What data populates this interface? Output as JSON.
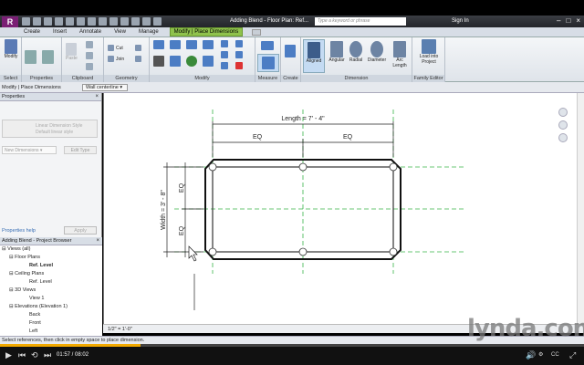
{
  "titlebar": {
    "app_logo": "R",
    "title": "Adding Blend - Floor Plan: Ref...",
    "search_placeholder": "Type a keyword or phrase",
    "sign_in": "Sign In"
  },
  "tabs": [
    "Create",
    "Insert",
    "Annotate",
    "View",
    "Manage",
    "Modify | Place Dimensions"
  ],
  "active_tab": "Modify | Place Dimensions",
  "ribbon": {
    "select": {
      "modify": "Modify",
      "label": "Select"
    },
    "properties": {
      "label": "Properties"
    },
    "clipboard": {
      "paste": "Paste",
      "label": "Clipboard"
    },
    "geometry": {
      "cut": "Cut",
      "join": "Join",
      "label": "Geometry"
    },
    "modify": {
      "label": "Modify"
    },
    "measure": {
      "label": "Measure"
    },
    "create": {
      "label": "Create"
    },
    "dimension": {
      "label": "Dimension",
      "tools": [
        "Aligned",
        "Angular",
        "Radial",
        "Diameter",
        "Arc Length"
      ]
    },
    "family_editor": {
      "load": "Load into Project",
      "label": "Family Editor"
    }
  },
  "options_bar": {
    "context": "Modify | Place Dimensions",
    "reference": "Wall centerline"
  },
  "properties_panel": {
    "title": "Properties",
    "type_line1": "Linear Dimension Style",
    "type_line2": "Default linear style",
    "type_selector": "New Dimensions",
    "edit_type": "Edit Type",
    "help": "Properties help",
    "apply": "Apply"
  },
  "project_browser": {
    "title": "Adding Blend - Project Browser",
    "tree": [
      {
        "label": "Views (all)",
        "level": 0
      },
      {
        "label": "Floor Plans",
        "level": 1
      },
      {
        "label": "Ref. Level",
        "level": 2,
        "bold": true
      },
      {
        "label": "Ceiling Plans",
        "level": 1
      },
      {
        "label": "Ref. Level",
        "level": 2
      },
      {
        "label": "3D Views",
        "level": 1
      },
      {
        "label": "View 1",
        "level": 2
      },
      {
        "label": "Elevations (Elevation 1)",
        "level": 1
      },
      {
        "label": "Back",
        "level": 2
      },
      {
        "label": "Front",
        "level": 2
      },
      {
        "label": "Left",
        "level": 2
      }
    ]
  },
  "drawing": {
    "length_label": "Length = 7' - 4\"",
    "width_label": "Width = 3' - 8\"",
    "eq": "EQ"
  },
  "view_control_bar": {
    "scale": "1/2\" = 1'-0\""
  },
  "status": "Select references, then click in empty space to place dimension.",
  "player": {
    "current_time": "01:57",
    "total_time": "08:02",
    "progress_fraction": 0.24,
    "watermark": "lynda.com"
  }
}
